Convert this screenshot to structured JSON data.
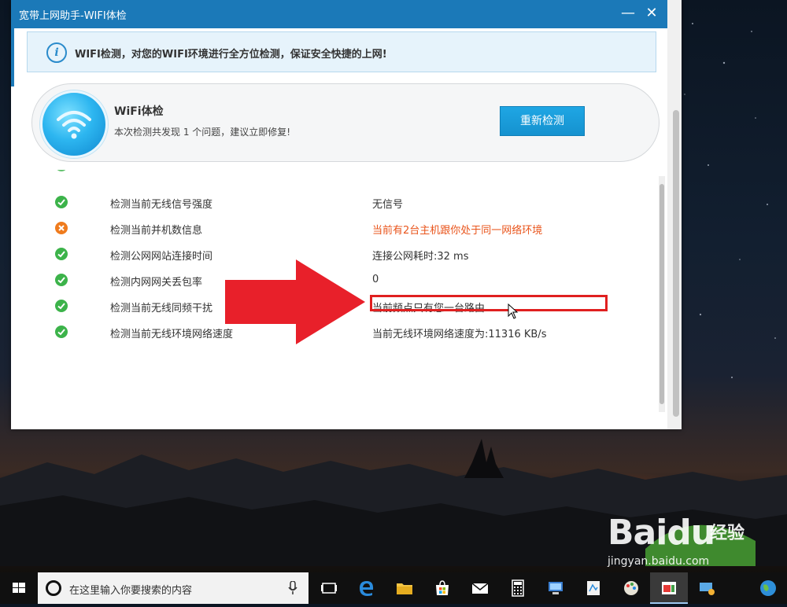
{
  "window": {
    "title": "宽带上网助手-WIFI体检",
    "minimize_label": "—",
    "close_label": "✕"
  },
  "notice": {
    "text": "WIFI检测，对您的WIFI环境进行全方位检测，保证安全快捷的上网!"
  },
  "summary": {
    "title": "WiFi体检",
    "subtitle": "本次检测共发现 1 个问题，建议立即修复!",
    "recheck_button": "重新检测"
  },
  "checks": [
    {
      "name": "检测当前无线信号强度",
      "result": "无信号",
      "status": "ok"
    },
    {
      "name": "检测当前并机数信息",
      "result": "当前有2台主机跟你处于同一网络环境",
      "status": "warning"
    },
    {
      "name": "检测公网网站连接时间",
      "result": "连接公网耗时:32 ms",
      "status": "ok"
    },
    {
      "name": "检测内网网关丢包率",
      "result": "0",
      "status": "ok"
    },
    {
      "name": "检测当前无线同频干扰",
      "result": "当前频点只有您一台路由",
      "status": "ok"
    },
    {
      "name": "检测当前无线环境网络速度",
      "result": "当前无线环境网络速度为:11316 KB/s",
      "status": "ok"
    }
  ],
  "colors": {
    "titlebar": "#1b79b8",
    "ok": "#3cb34a",
    "warning": "#ef7b1d",
    "warning_text": "#e9541b",
    "button": "#1592cf",
    "annotation": "#e02020"
  },
  "watermark": {
    "logo": "Baidu",
    "cn": "经验",
    "url": "jingyan.baidu.com"
  },
  "taskbar": {
    "search_placeholder": "在这里输入你要搜索的内容",
    "icons": [
      "windows-start-icon",
      "cortana-icon",
      "microphone-icon",
      "task-view-icon",
      "edge-icon",
      "file-explorer-icon",
      "store-icon",
      "mail-icon",
      "calculator-icon",
      "network-app-icon",
      "paint-icon",
      "colors-icon",
      "active-app-icon",
      "remote-icon",
      "globe-icon"
    ]
  }
}
